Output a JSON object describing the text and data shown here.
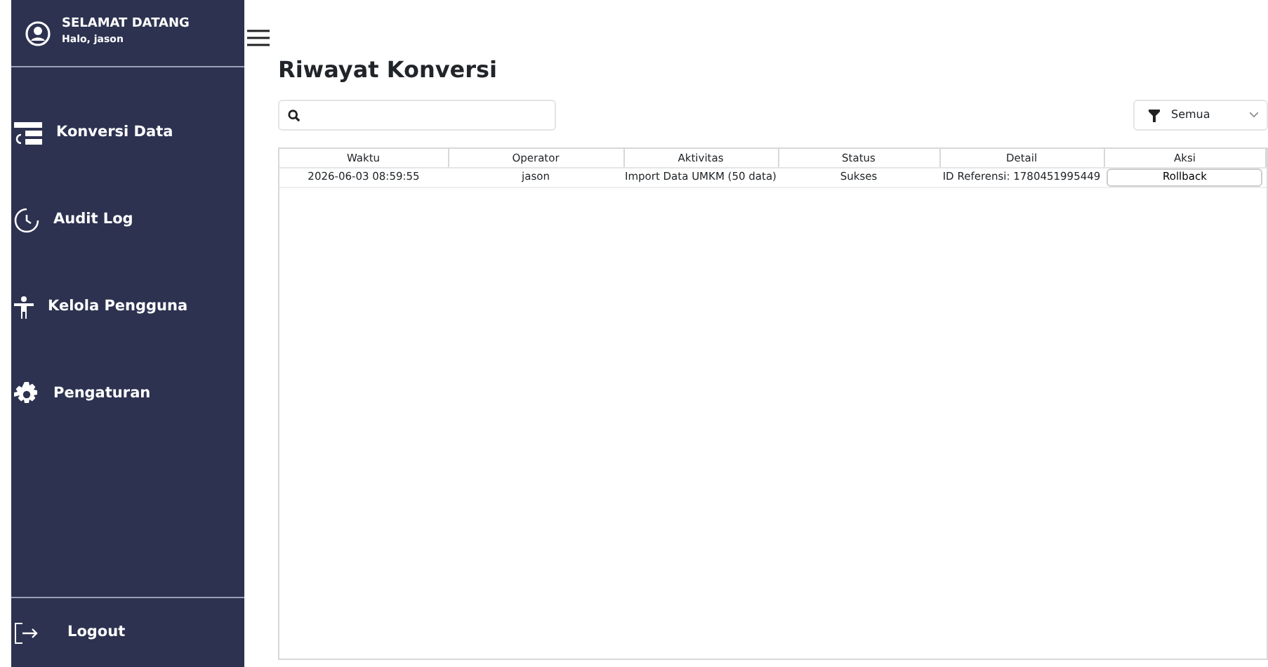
{
  "sidebar": {
    "greeting": "SELAMAT DATANG",
    "user": "Halo, jason",
    "items": [
      {
        "label": "Konversi Data",
        "kind": "convert"
      },
      {
        "label": "Audit Log",
        "kind": "history"
      },
      {
        "label": "Kelola Pengguna",
        "kind": "person"
      },
      {
        "label": "Pengaturan",
        "kind": "gear"
      }
    ],
    "logout": "Logout"
  },
  "page_title": "Riwayat Konversi",
  "filter": {
    "value": "Semua"
  },
  "table": {
    "columns": [
      "Waktu",
      "Operator",
      "Aktivitas",
      "Status",
      "Detail",
      "Aksi"
    ],
    "rows": [
      {
        "cells": [
          "2026-06-03 08:59:55",
          "jason",
          "Import Data UMKM (50 data)",
          "Sukses",
          "ID Referensi: 1780451995449"
        ],
        "action": "Rollback"
      }
    ]
  }
}
